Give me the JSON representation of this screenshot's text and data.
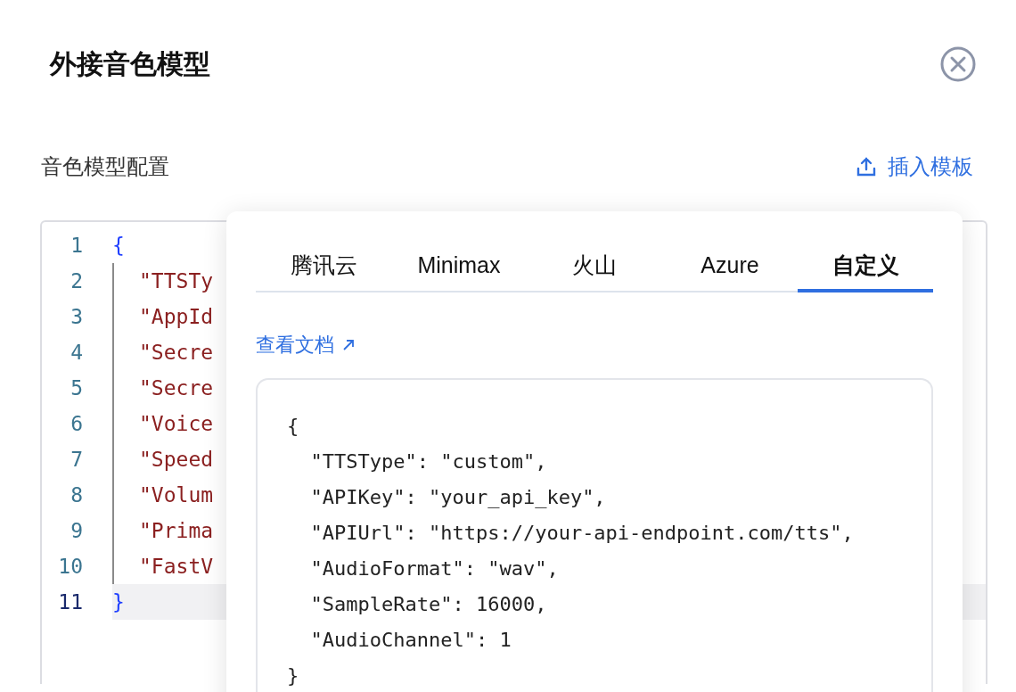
{
  "dialog": {
    "title": "外接音色模型"
  },
  "section": {
    "label": "音色模型配置",
    "insert_button": "插入模板"
  },
  "editor": {
    "lines": [
      {
        "number": "1",
        "text": "{",
        "kind": "brace",
        "active": false
      },
      {
        "number": "2",
        "text": "\"TTSTy",
        "kind": "key",
        "active": false
      },
      {
        "number": "3",
        "text": "\"AppId",
        "kind": "key",
        "active": false
      },
      {
        "number": "4",
        "text": "\"Secre",
        "kind": "key",
        "active": false
      },
      {
        "number": "5",
        "text": "\"Secre",
        "kind": "key",
        "active": false
      },
      {
        "number": "6",
        "text": "\"Voice",
        "kind": "key",
        "active": false
      },
      {
        "number": "7",
        "text": "\"Speed",
        "kind": "key",
        "active": false
      },
      {
        "number": "8",
        "text": "\"Volum",
        "kind": "key",
        "active": false
      },
      {
        "number": "9",
        "text": "\"Prima",
        "kind": "key",
        "active": false
      },
      {
        "number": "10",
        "text": "\"FastV",
        "kind": "key",
        "active": false
      },
      {
        "number": "11",
        "text": "}",
        "kind": "brace",
        "active": true
      }
    ]
  },
  "template_popover": {
    "tabs": [
      {
        "label": "腾讯云",
        "selected": false
      },
      {
        "label": "Minimax",
        "selected": false
      },
      {
        "label": "火山",
        "selected": false
      },
      {
        "label": "Azure",
        "selected": false
      },
      {
        "label": "自定义",
        "selected": true
      }
    ],
    "doc_link": "查看文档",
    "code": [
      "{",
      "  \"TTSType\": \"custom\",",
      "  \"APIKey\": \"your_api_key\",",
      "  \"APIUrl\": \"https://your-api-endpoint.com/tts\",",
      "  \"AudioFormat\": \"wav\",",
      "  \"SampleRate\": 16000,",
      "  \"AudioChannel\": 1",
      "}"
    ]
  }
}
